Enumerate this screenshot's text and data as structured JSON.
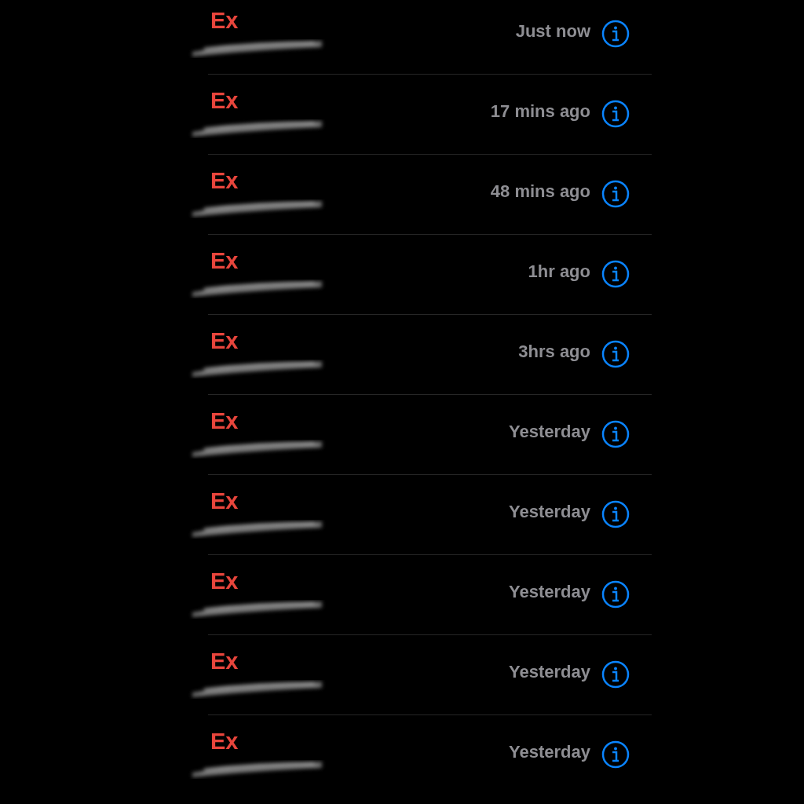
{
  "calls": [
    {
      "name": "Ex",
      "missed": true,
      "time": "Just now"
    },
    {
      "name": "Ex",
      "missed": true,
      "time": "17 mins ago"
    },
    {
      "name": "Ex",
      "missed": true,
      "time": "48 mins ago"
    },
    {
      "name": "Ex",
      "missed": true,
      "time": "1hr ago"
    },
    {
      "name": "Ex",
      "missed": true,
      "time": "3hrs ago"
    },
    {
      "name": "Ex",
      "missed": true,
      "time": "Yesterday"
    },
    {
      "name": "Ex",
      "missed": true,
      "time": "Yesterday"
    },
    {
      "name": "Ex",
      "missed": true,
      "time": "Yesterday"
    },
    {
      "name": "Ex",
      "missed": true,
      "time": "Yesterday"
    },
    {
      "name": "Ex",
      "missed": true,
      "time": "Yesterday"
    }
  ]
}
